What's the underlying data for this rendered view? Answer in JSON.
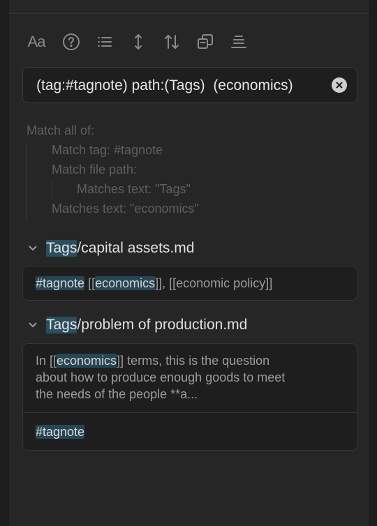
{
  "toolbar": {
    "buttons": [
      {
        "name": "Aa",
        "icon": "match-case-icon"
      },
      {
        "icon": "help-circle-icon"
      },
      {
        "icon": "list-icon"
      },
      {
        "icon": "expand-vertical-icon"
      },
      {
        "icon": "sort-icon"
      },
      {
        "icon": "copy-icon"
      },
      {
        "icon": "align-icon"
      }
    ]
  },
  "search": {
    "value": "(tag:#tagnote) path:(Tags)  (economics)",
    "clear_icon": "clear-circle-icon"
  },
  "explain": {
    "match_all": "Match all of:",
    "match_tag": "Match tag: #tagnote",
    "match_path": "Match file path:",
    "matches_tags": "Matches text: \"Tags\"",
    "matches_economics": "Matches text: \"economics\""
  },
  "results": [
    {
      "file_prefix": "Tags",
      "file_rest": "/capital assets.md",
      "line": {
        "tag": "#tagnote",
        "open1": " [[",
        "kw": "economics",
        "rest": "]], [[economic policy]]"
      }
    },
    {
      "file_prefix": "Tags",
      "file_rest": "/problem of production.md",
      "para": {
        "pre": "In [[",
        "kw": "economics",
        "line1_rest": "]] terms, this is the question",
        "line2": "about how to produce enough goods to meet",
        "line3": "the needs of the people **a..."
      },
      "tag": "#tagnote"
    }
  ],
  "colors": {
    "background": "#1e1e1e",
    "panel": "#262626",
    "highlight": "#274654",
    "muted_text": "#5f5f5f"
  }
}
